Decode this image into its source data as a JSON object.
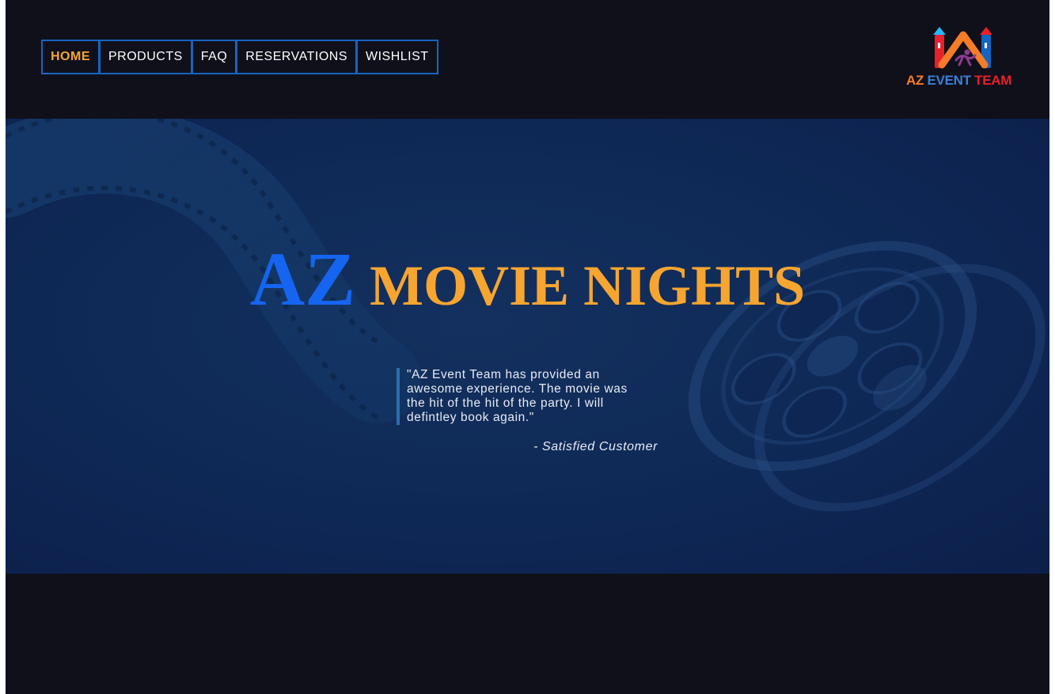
{
  "nav": {
    "items": [
      {
        "label": "HOME",
        "active": true
      },
      {
        "label": "PRODUCTS",
        "active": false
      },
      {
        "label": "FAQ",
        "active": false
      },
      {
        "label": "RESERVATIONS",
        "active": false
      },
      {
        "label": "WISHLIST",
        "active": false
      }
    ]
  },
  "logo": {
    "word_az": "AZ",
    "word_event": "EVENT",
    "word_team": "TEAM"
  },
  "hero": {
    "title_big": "AZ",
    "title_rest": "MOVIE NIGHTS",
    "quote": "\"AZ Event Team has provided an awesome experience. The movie was the hit of the hit of the party. I will defintley book again.\"",
    "quote_author": "- Satisfied Customer"
  },
  "colors": {
    "accent_orange": "#f7a531",
    "accent_blue": "#1565f0",
    "nav_border": "#1565c0",
    "background": "#10101b",
    "hero_bg": "#0f2a57"
  }
}
